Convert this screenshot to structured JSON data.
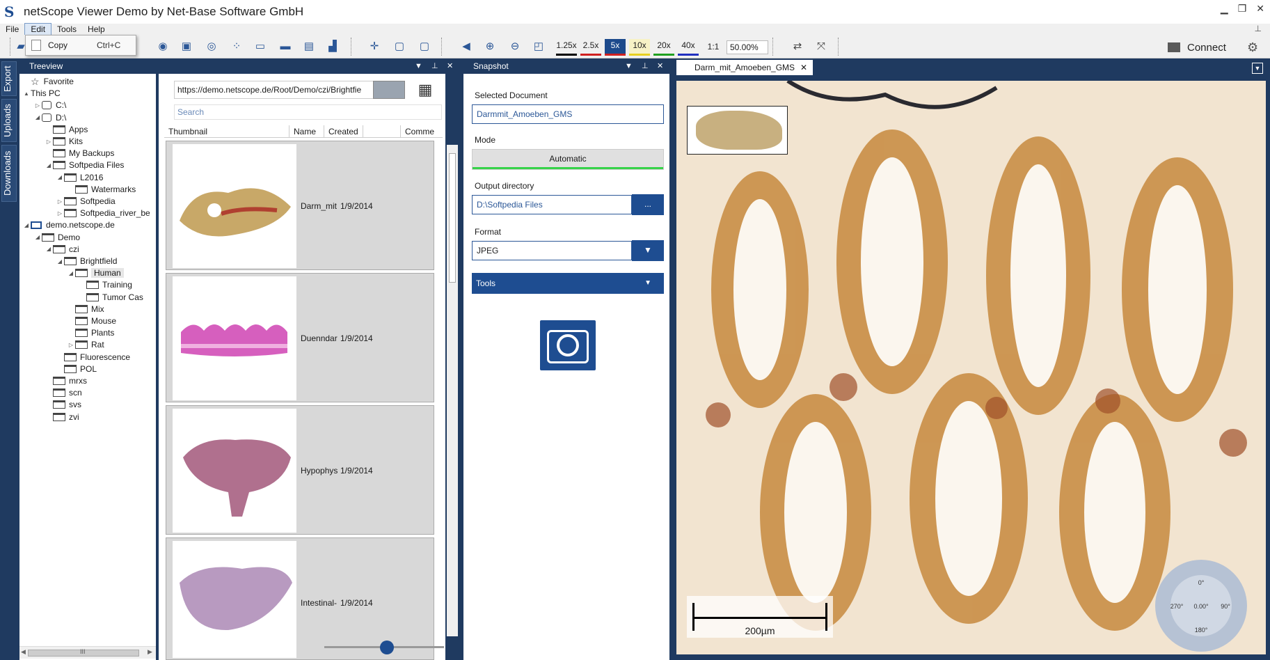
{
  "window": {
    "title": "netScope Viewer Demo by Net-Base Software GmbH",
    "logo": "S"
  },
  "menu": {
    "items": [
      "File",
      "Edit",
      "Tools",
      "Help"
    ],
    "active": "Edit"
  },
  "edit_menu": {
    "copy_label": "Copy",
    "copy_shortcut": "Ctrl+C"
  },
  "toolbar": {
    "zoom_levels": [
      {
        "label": "1.25x",
        "color": "#000000"
      },
      {
        "label": "2.5x",
        "color": "#d02020"
      },
      {
        "label": "5x",
        "color": "#d02020"
      },
      {
        "label": "10x",
        "color": "#e8d020"
      },
      {
        "label": "20x",
        "color": "#20a020"
      },
      {
        "label": "40x",
        "color": "#2030c0"
      }
    ],
    "one_to_one": "1:1",
    "zoom_value": "50.00%",
    "connect_label": "Connect"
  },
  "side_tabs": [
    "Export",
    "Uploads",
    "Downloads"
  ],
  "treeview": {
    "title": "Treeview",
    "nodes": [
      {
        "label": "Favorite",
        "level": 0,
        "icon": "star"
      },
      {
        "label": "This PC",
        "level": 0,
        "icon": "none",
        "arrow": "▲"
      },
      {
        "label": "C:\\",
        "level": 1,
        "icon": "drive",
        "arrow": "▷"
      },
      {
        "label": "D:\\",
        "level": 1,
        "icon": "drive",
        "arrow": "◢"
      },
      {
        "label": "Apps",
        "level": 2,
        "icon": "folder"
      },
      {
        "label": "Kits",
        "level": 2,
        "icon": "folder",
        "arrow": "▷"
      },
      {
        "label": "My Backups",
        "level": 2,
        "icon": "folder"
      },
      {
        "label": "Softpedia Files",
        "level": 2,
        "icon": "folder",
        "arrow": "◢"
      },
      {
        "label": "L2016",
        "level": 3,
        "icon": "folder",
        "arrow": "◢"
      },
      {
        "label": "Watermarks",
        "level": 4,
        "icon": "folder"
      },
      {
        "label": "Softpedia",
        "level": 3,
        "icon": "folder",
        "arrow": "▷"
      },
      {
        "label": "Softpedia_river_be",
        "level": 3,
        "icon": "folder",
        "arrow": "▷"
      },
      {
        "label": "demo.netscope.de",
        "level": 0,
        "icon": "server",
        "arrow": "◢"
      },
      {
        "label": "Demo",
        "level": 1,
        "icon": "folder",
        "arrow": "◢"
      },
      {
        "label": "czi",
        "level": 2,
        "icon": "folder",
        "arrow": "◢"
      },
      {
        "label": "Brightfield",
        "level": 3,
        "icon": "folder",
        "arrow": "◢"
      },
      {
        "label": "Human",
        "level": 4,
        "icon": "folder",
        "arrow": "◢"
      },
      {
        "label": "Training",
        "level": 5,
        "icon": "folder"
      },
      {
        "label": "Tumor Cas",
        "level": 5,
        "icon": "folder"
      },
      {
        "label": "Mix",
        "level": 4,
        "icon": "folder"
      },
      {
        "label": "Mouse",
        "level": 4,
        "icon": "folder"
      },
      {
        "label": "Plants",
        "level": 4,
        "icon": "folder"
      },
      {
        "label": "Rat",
        "level": 4,
        "icon": "folder",
        "arrow": "▷"
      },
      {
        "label": "Fluorescence",
        "level": 3,
        "icon": "folder"
      },
      {
        "label": "POL",
        "level": 3,
        "icon": "folder"
      },
      {
        "label": "mrxs",
        "level": 2,
        "icon": "folder"
      },
      {
        "label": "scn",
        "level": 2,
        "icon": "folder"
      },
      {
        "label": "svs",
        "level": 2,
        "icon": "folder"
      },
      {
        "label": "zvi",
        "level": 2,
        "icon": "folder"
      }
    ],
    "hscroll_label": "III"
  },
  "browser": {
    "url": "https://demo.netscope.de/Root/Demo/czi/Brightfie",
    "search_placeholder": "Search",
    "columns": [
      "Thumbnail",
      "Name",
      "Created",
      "",
      "Comme"
    ],
    "rows": [
      {
        "name": "Darm_mit",
        "created": "1/9/2014"
      },
      {
        "name": "Duenndar",
        "created": "1/9/2014"
      },
      {
        "name": "Hypophys",
        "created": "1/9/2014"
      },
      {
        "name": "Intestinal-",
        "created": "1/9/2014"
      }
    ]
  },
  "snapshot": {
    "title": "Snapshot",
    "selected_document_label": "Selected Document",
    "selected_document": "Darmmit_Amoeben_GMS",
    "mode_label": "Mode",
    "mode_value": "Automatic",
    "output_dir_label": "Output directory",
    "output_dir": "D:\\Softpedia Files",
    "browse_label": "...",
    "format_label": "Format",
    "format_value": "JPEG",
    "tools_label": "Tools"
  },
  "viewer": {
    "tab_label": "Darm_mit_Amoeben_GMS",
    "scale_label": "200µm",
    "rotation": {
      "top": "0°",
      "right": "90°",
      "bottom": "180°",
      "left": "270°",
      "center": "0.00°"
    }
  },
  "colors": {
    "accent": "#1e4d91",
    "panel_bg": "#1f3a60",
    "mode_progress": "#37d34a"
  }
}
